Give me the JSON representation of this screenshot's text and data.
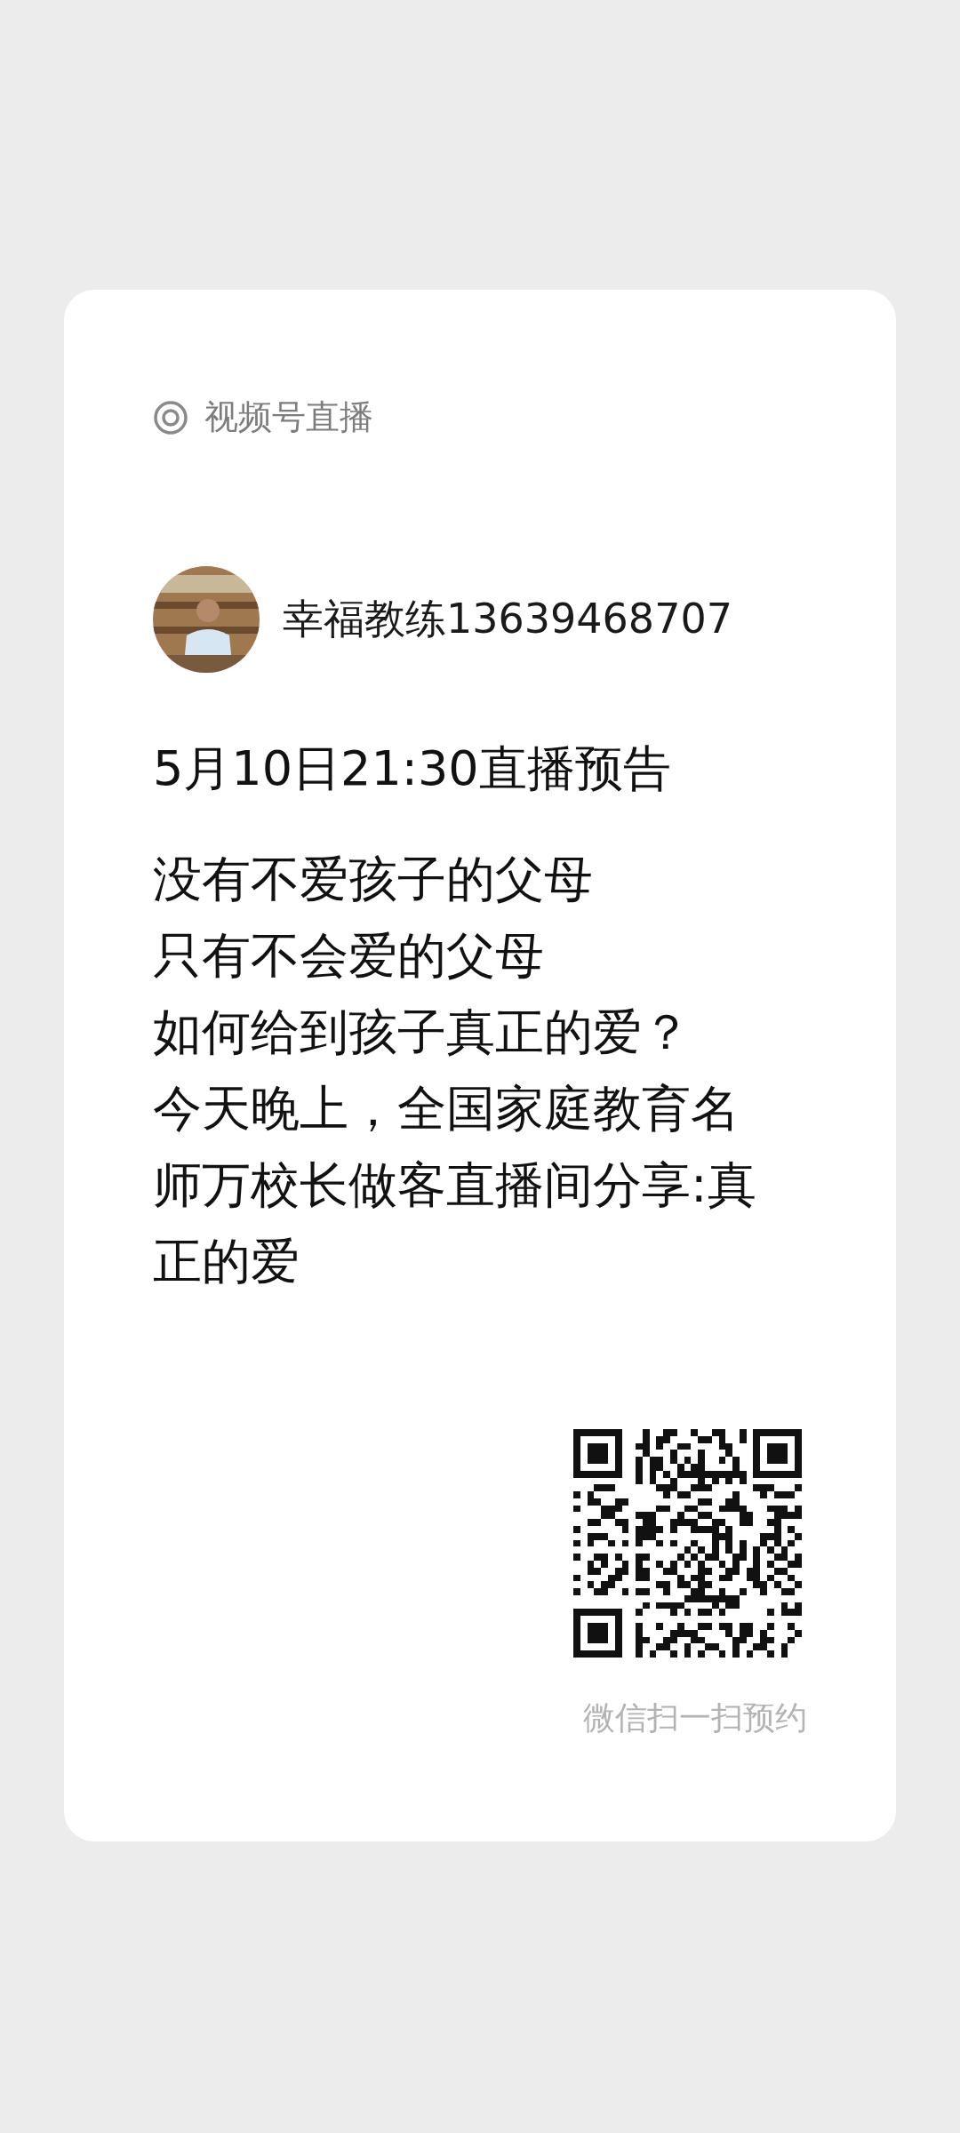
{
  "card": {
    "source_label": "视频号直播",
    "host": {
      "name": "幸福教练13639468707"
    },
    "title": "5月10日21:30直播预告",
    "body_lines": [
      "没有不爱孩子的父母",
      "只有不会爱的父母",
      "如何给到孩子真正的爱？",
      "今天晚上，全国家庭教育名",
      "师万校长做客直播间分享:真",
      "正的爱"
    ],
    "qr_caption": "微信扫一扫预约"
  }
}
